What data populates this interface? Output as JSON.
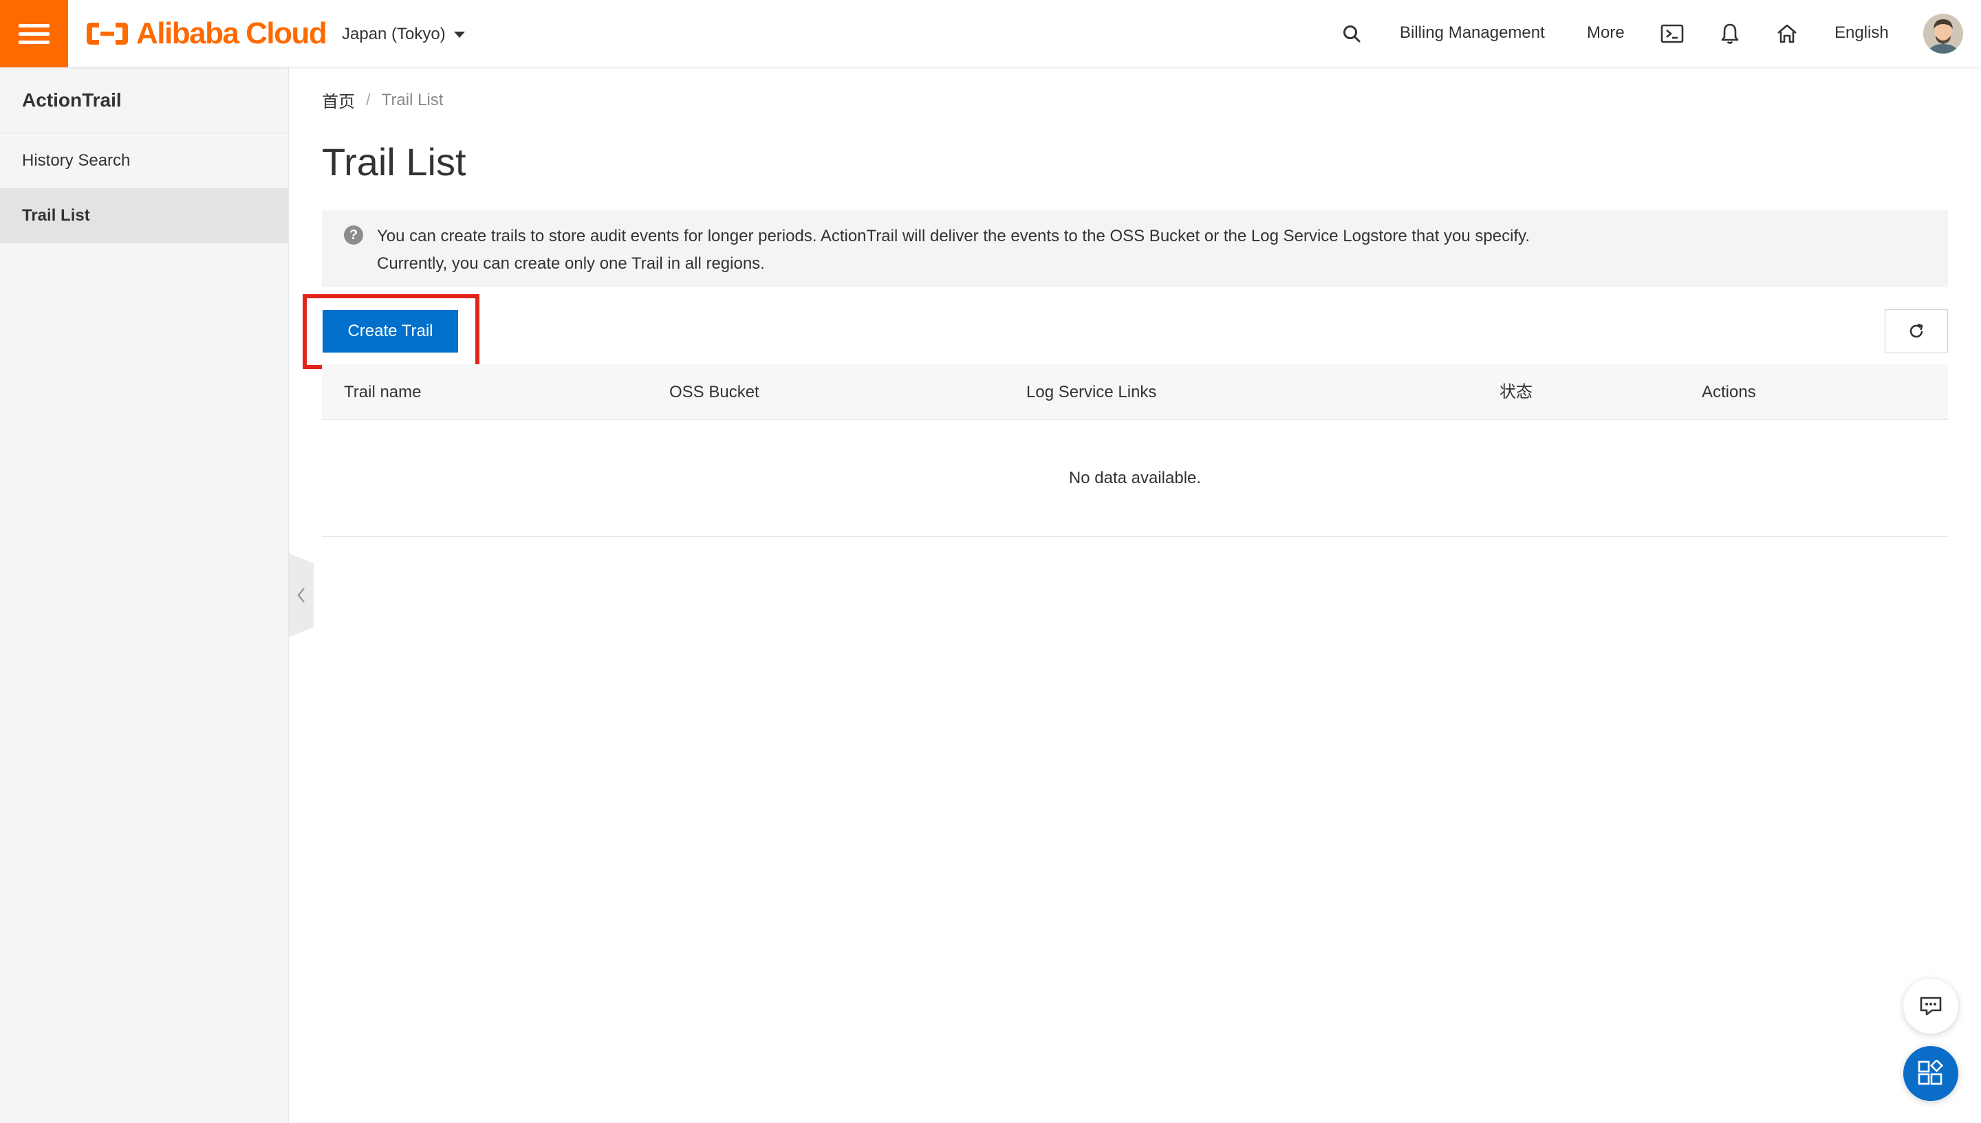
{
  "colors": {
    "brand_orange": "#ff6a00",
    "primary_blue": "#0070cc",
    "highlight_red": "#e1251b",
    "sidebar_bg": "#f5f5f5"
  },
  "topbar": {
    "menu_icon": "hamburger-menu-icon",
    "logo_text": "Alibaba Cloud",
    "region": "Japan (Tokyo)",
    "search_icon": "search-icon",
    "billing": "Billing Management",
    "more": "More",
    "terminal_icon": "terminal-icon",
    "notification_icon": "bell-icon",
    "home_icon": "home-icon",
    "language": "English",
    "avatar_icon": "user-avatar"
  },
  "sidebar": {
    "title": "ActionTrail",
    "items": [
      {
        "label": "History Search",
        "active": false
      },
      {
        "label": "Trail List",
        "active": true
      }
    ],
    "collapse_icon": "chevron-left-icon"
  },
  "main": {
    "breadcrumb": {
      "home": "首页",
      "separator": "/",
      "current": "Trail List"
    },
    "title": "Trail List",
    "notice": {
      "icon": "question-circle-icon",
      "line1": "You can create trails to store audit events for longer periods. ActionTrail will deliver the events to the OSS Bucket or the Log Service Logstore that you specify.",
      "line2": "Currently, you can create only one Trail in all regions."
    },
    "create_button": "Create Trail",
    "refresh_icon": "refresh-icon",
    "table": {
      "columns": [
        "Trail name",
        "OSS Bucket",
        "Log Service Links",
        "状态",
        "Actions"
      ],
      "rows": [],
      "empty_text": "No data available."
    }
  },
  "floating": {
    "chat_icon": "chat-icon",
    "apps_icon": "apps-grid-icon"
  }
}
